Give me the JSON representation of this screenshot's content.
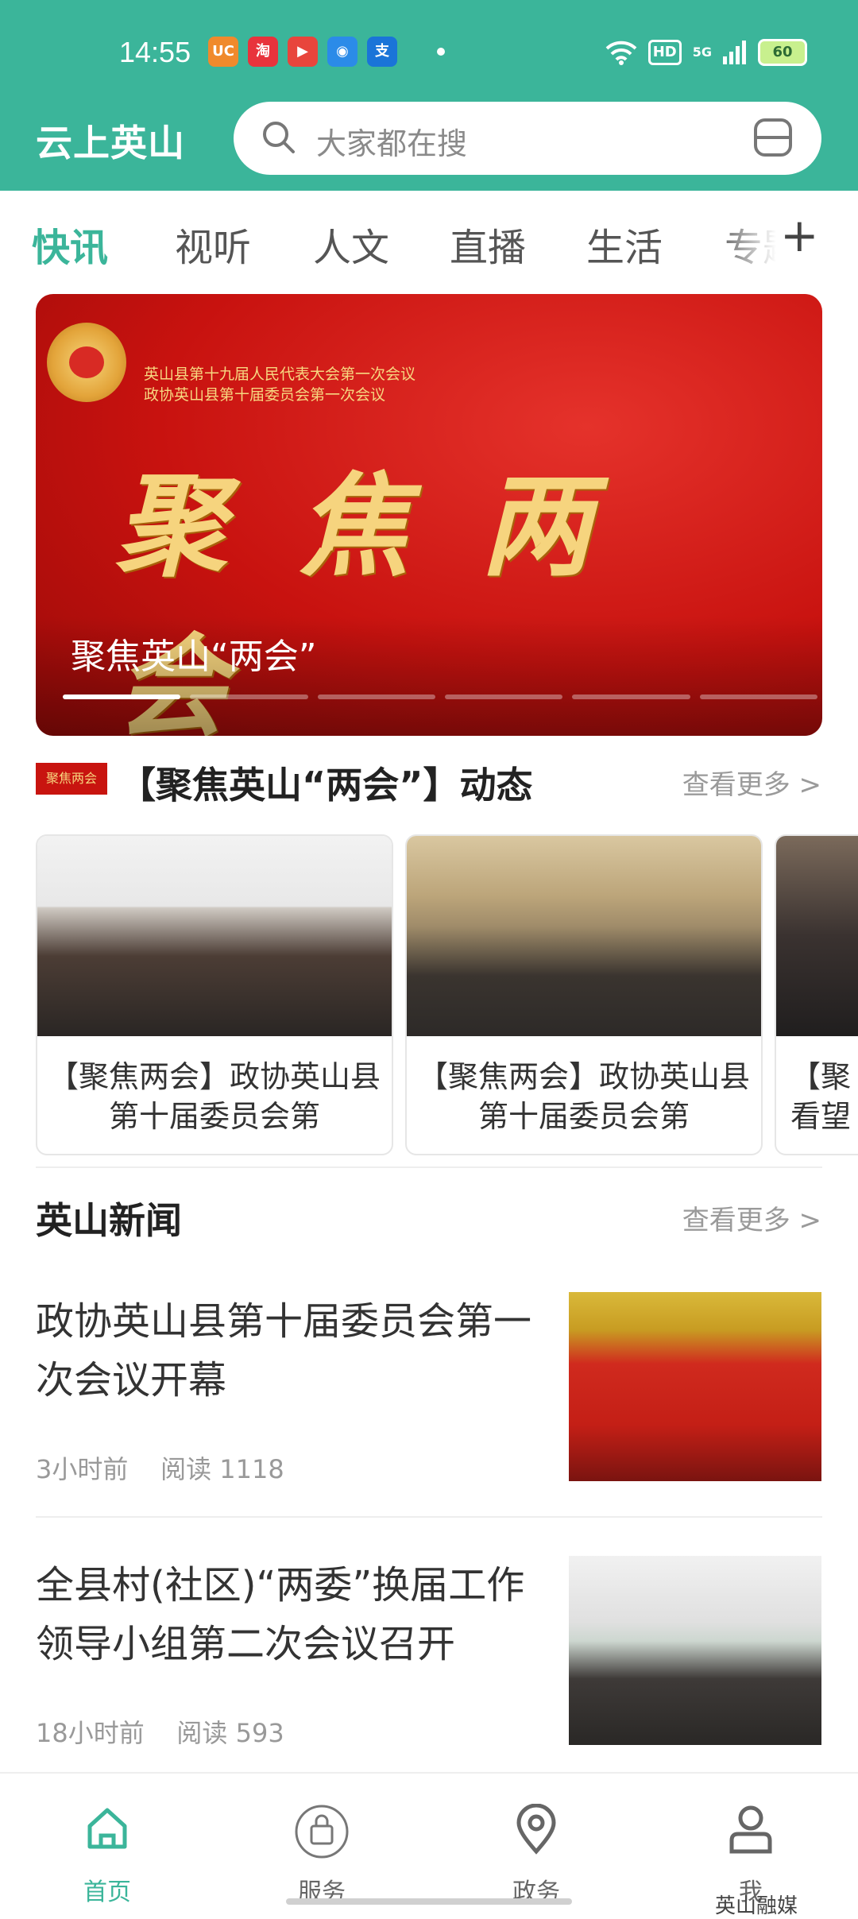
{
  "status_bar": {
    "time": "14:55",
    "notification_apps": [
      "UC",
      "淘",
      "▶",
      "◉",
      "支"
    ],
    "hd": "HD",
    "network": "5G",
    "battery": "60"
  },
  "header": {
    "app_title": "云上英山",
    "search_placeholder": "大家都在搜",
    "accent": "#3bb59a"
  },
  "tabs": [
    {
      "label": "快讯",
      "active": true
    },
    {
      "label": "视听",
      "active": false
    },
    {
      "label": "人文",
      "active": false
    },
    {
      "label": "直播",
      "active": false
    },
    {
      "label": "生活",
      "active": false
    },
    {
      "label": "专题",
      "active": false
    }
  ],
  "tabs_add": "+",
  "banner": {
    "line1": "英山县第十九届人民代表大会第一次会议",
    "line2": "政协英山县第十届委员会第一次会议",
    "calligraphy": "聚焦两会",
    "caption": "聚焦英山“两会”",
    "slides": 6,
    "current_slide": 1
  },
  "section1": {
    "icon_text": "聚焦两会",
    "title": "【聚焦英山“两会”】动态",
    "more": "查看更多 >",
    "cards": [
      {
        "title": "【聚焦两会】政协英山县第十届委员会第"
      },
      {
        "title": "【聚焦两会】政协英山县第十届委员会第"
      },
      {
        "title": "【聚看望"
      }
    ]
  },
  "section2": {
    "title": "英山新闻",
    "more": "查看更多 >",
    "items": [
      {
        "title": "政协英山县第十届委员会第一次会议开幕",
        "time": "3小时前",
        "reads": "阅读 1118"
      },
      {
        "title": "全县村(社区)“两委”换届工作领导小组第二次会议召开",
        "time": "18小时前",
        "reads": "阅读 593"
      }
    ]
  },
  "bottom_nav": [
    {
      "label": "首页",
      "icon": "home-icon",
      "active": true
    },
    {
      "label": "服务",
      "icon": "bag-icon",
      "active": false
    },
    {
      "label": "政务",
      "icon": "location-pin-icon",
      "active": false
    },
    {
      "label": "我",
      "icon": "person-icon",
      "active": false
    }
  ],
  "watermark": "英山融媒"
}
